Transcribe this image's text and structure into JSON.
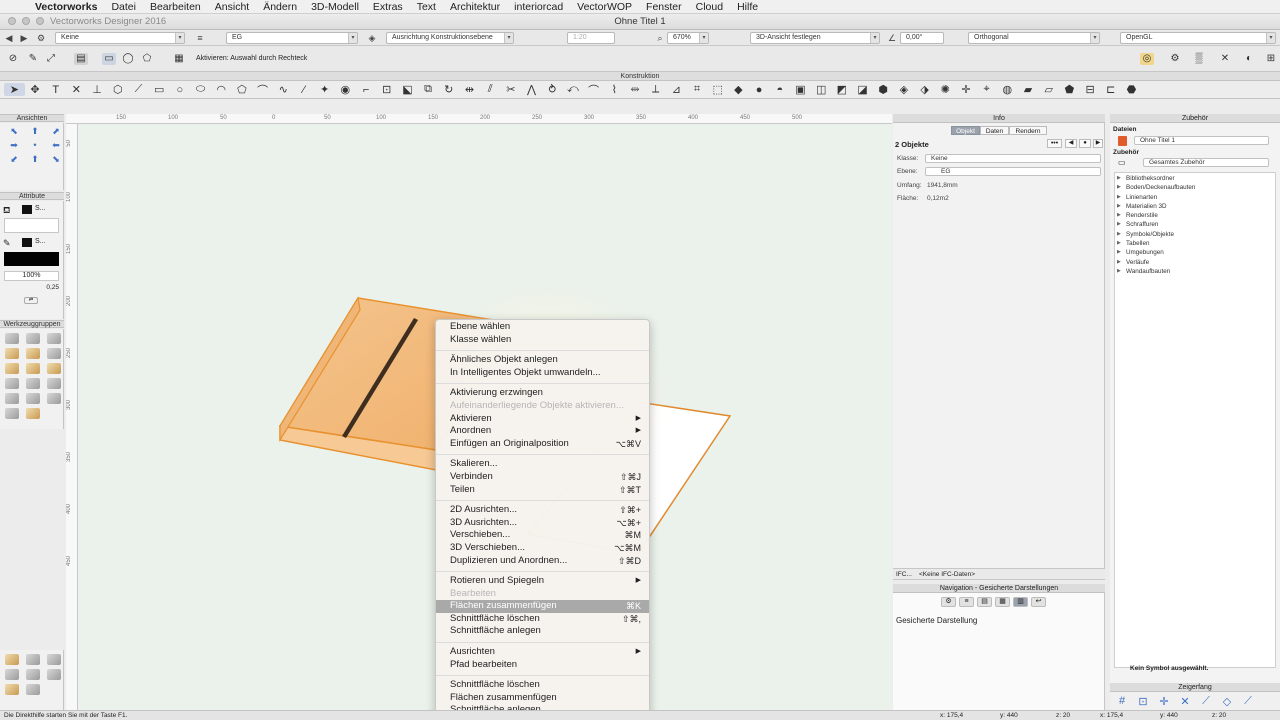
{
  "menubar": {
    "items": [
      "Vectorworks",
      "Datei",
      "Bearbeiten",
      "Ansicht",
      "Ändern",
      "3D-Modell",
      "Extras",
      "Text",
      "Architektur",
      "interiorcad",
      "VectorWOP",
      "Fenster",
      "Cloud",
      "Hilfe"
    ]
  },
  "titlebar": {
    "app_title": "Vectorworks Designer 2016",
    "doc_title": "Ohne Titel 1"
  },
  "viewbar": {
    "class": "Keine",
    "layer": "EG",
    "working_plane": "Ausrichtung Konstruktionsebene",
    "scale": "1:20",
    "zoom": "670%",
    "view": "3D-Ansicht festlegen",
    "angle": "0,00°",
    "projection": "Orthogonal",
    "render": "OpenGL"
  },
  "modebar": {
    "label": "Aktivieren: Auswahl durch Rechteck"
  },
  "palettes": {
    "konstruktion": "Konstruktion",
    "ansichten": "Ansichten",
    "attribute": "Attribute",
    "werkzeuggruppen": "Werkzeuggruppen",
    "info": "Info",
    "zubehoer": "Zubehör",
    "navigation": "Navigation - Gesicherte Darstellungen",
    "zeigerfang": "Zeigerfang"
  },
  "attribute": {
    "fill_label": "S...",
    "pen_label": "S...",
    "opacity": "100%",
    "line_weight": "0,25"
  },
  "rulers": {
    "top": [
      "150",
      "100",
      "50",
      "0",
      "50",
      "100",
      "150",
      "200",
      "250",
      "300",
      "350",
      "400",
      "450",
      "500"
    ],
    "left": [
      "50",
      "100",
      "150",
      "200",
      "250",
      "300",
      "350",
      "400",
      "450"
    ]
  },
  "context_menu": {
    "groups": [
      [
        {
          "label": "Ebene wählen"
        },
        {
          "label": "Klasse wählen"
        }
      ],
      [
        {
          "label": "Ähnliches Objekt anlegen"
        },
        {
          "label": "In Intelligentes Objekt umwandeln..."
        }
      ],
      [
        {
          "label": "Aktivierung erzwingen"
        },
        {
          "label": "Aufeinanderliegende Objekte aktivieren...",
          "disabled": true
        },
        {
          "label": "Aktivieren",
          "submenu": true
        },
        {
          "label": "Anordnen",
          "submenu": true
        },
        {
          "label": "Einfügen an Originalposition",
          "shortcut": "⌥⌘V"
        }
      ],
      [
        {
          "label": "Skalieren..."
        },
        {
          "label": "Verbinden",
          "shortcut": "⇧⌘J"
        },
        {
          "label": "Teilen",
          "shortcut": "⇧⌘T"
        }
      ],
      [
        {
          "label": "2D Ausrichten...",
          "shortcut": "⇧⌘+"
        },
        {
          "label": "3D Ausrichten...",
          "shortcut": "⌥⌘+"
        },
        {
          "label": "Verschieben...",
          "shortcut": "⌘M"
        },
        {
          "label": "3D Verschieben...",
          "shortcut": "⌥⌘M"
        },
        {
          "label": "Duplizieren und Anordnen...",
          "shortcut": "⇧⌘D"
        }
      ],
      [
        {
          "label": "Rotieren und Spiegeln",
          "submenu": true
        },
        {
          "label": "Bearbeiten",
          "disabled": true
        },
        {
          "label": "Flächen zusammenfügen",
          "shortcut": "⌘K",
          "highlighted": true
        },
        {
          "label": "Schnittfläche löschen",
          "shortcut": "⇧⌘,"
        },
        {
          "label": "Schnittfläche anlegen"
        }
      ],
      [
        {
          "label": "Ausrichten",
          "submenu": true
        },
        {
          "label": "Pfad bearbeiten"
        }
      ],
      [
        {
          "label": "Schnittfläche löschen"
        },
        {
          "label": "Flächen zusammenfügen"
        },
        {
          "label": "Schnittfläche anlegen"
        }
      ]
    ]
  },
  "info": {
    "tabs": [
      "Objekt",
      "Daten",
      "Rendern"
    ],
    "count": "2 Objekte",
    "klasse_label": "Klasse:",
    "klasse_value": "Keine",
    "ebene_label": "Ebene:",
    "ebene_value": "EG",
    "umfang_label": "Umfang:",
    "umfang_value": "1941,8mm",
    "flaeche_label": "Fläche:",
    "flaeche_value": "0,12m2",
    "ifc_label": "IFC...",
    "ifc_value": "<Keine IFC-Daten>"
  },
  "navigation": {
    "header": "Gesicherte Darstellung"
  },
  "zubehoer": {
    "dateien_label": "Dateien",
    "datei_value": "Ohne Titel 1",
    "zubehoer_label": "Zubehör",
    "filter_value": "Gesamtes Zubehör",
    "items": [
      "Bibliotheksordner",
      "Boden/Deckenaufbauten",
      "Linienarten",
      "Materialien 3D",
      "Renderstile",
      "Schraffuren",
      "Symbole/Objekte",
      "Tabellen",
      "Umgebungen",
      "Verläufe",
      "Wandaufbauten"
    ],
    "no_symbol": "Kein Symbol ausgewählt."
  },
  "status": {
    "hint": "Die Direkthilfe starten Sie mit der Taste F1.",
    "x1": "x: 175,4",
    "y1": "y: 440",
    "z1": "z: 20",
    "x2": "x: 175,4",
    "y2": "y: 440",
    "z2": "z: 20"
  },
  "colors": {
    "accent": "#3d6fc4",
    "wood": "#f2b46a",
    "wood_edge": "#e8922f",
    "canvas": "#ebf2eb"
  }
}
